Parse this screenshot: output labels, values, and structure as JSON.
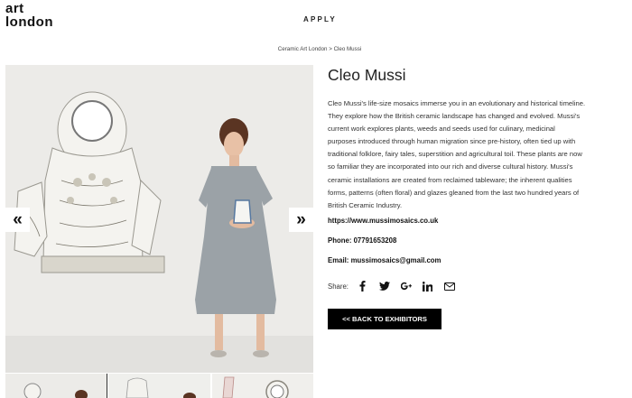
{
  "header": {
    "logo_line1": "art",
    "logo_line2": "london",
    "nav_apply": "APPLY"
  },
  "breadcrumb": {
    "parent": "Ceramic Art London",
    "separator": ">",
    "current": "Cleo Mussi"
  },
  "gallery": {
    "prev_arrow": "«",
    "next_arrow": "»",
    "thumbnail_count": 3
  },
  "artist": {
    "name": "Cleo Mussi",
    "bio_lines": [
      "Cleo Mussi's life-size mosaics immerse you in an evolutionary and historical timeline.",
      "They explore how the British ceramic landscape has changed and evolved. Mussi's",
      "current work explores plants, weeds and seeds used for culinary, medicinal",
      "purposes introduced through human migration since pre-history, often tied up with",
      "traditional folklore, fairy tales, superstition and agricultural toil. These plants are now",
      "so familiar they are incorporated into our rich and diverse cultural history. Mussi's",
      "ceramic installations are created from reclaimed tableware; the inherent qualities",
      "forms, patterns (often floral) and glazes gleaned from the last two hundred years of",
      "British Ceramic Industry."
    ],
    "website": "https://www.mussimosaics.co.uk",
    "phone": "Phone: 07791653208",
    "email": "Email: mussimosaics@gmail.com"
  },
  "share": {
    "label": "Share:",
    "icons": [
      "facebook-icon",
      "twitter-icon",
      "google-plus-icon",
      "linkedin-icon",
      "email-icon"
    ]
  },
  "back_button": "<< BACK TO EXHIBITORS",
  "colors": {
    "button_bg": "#000000",
    "button_text": "#ffffff",
    "text": "#222222"
  }
}
